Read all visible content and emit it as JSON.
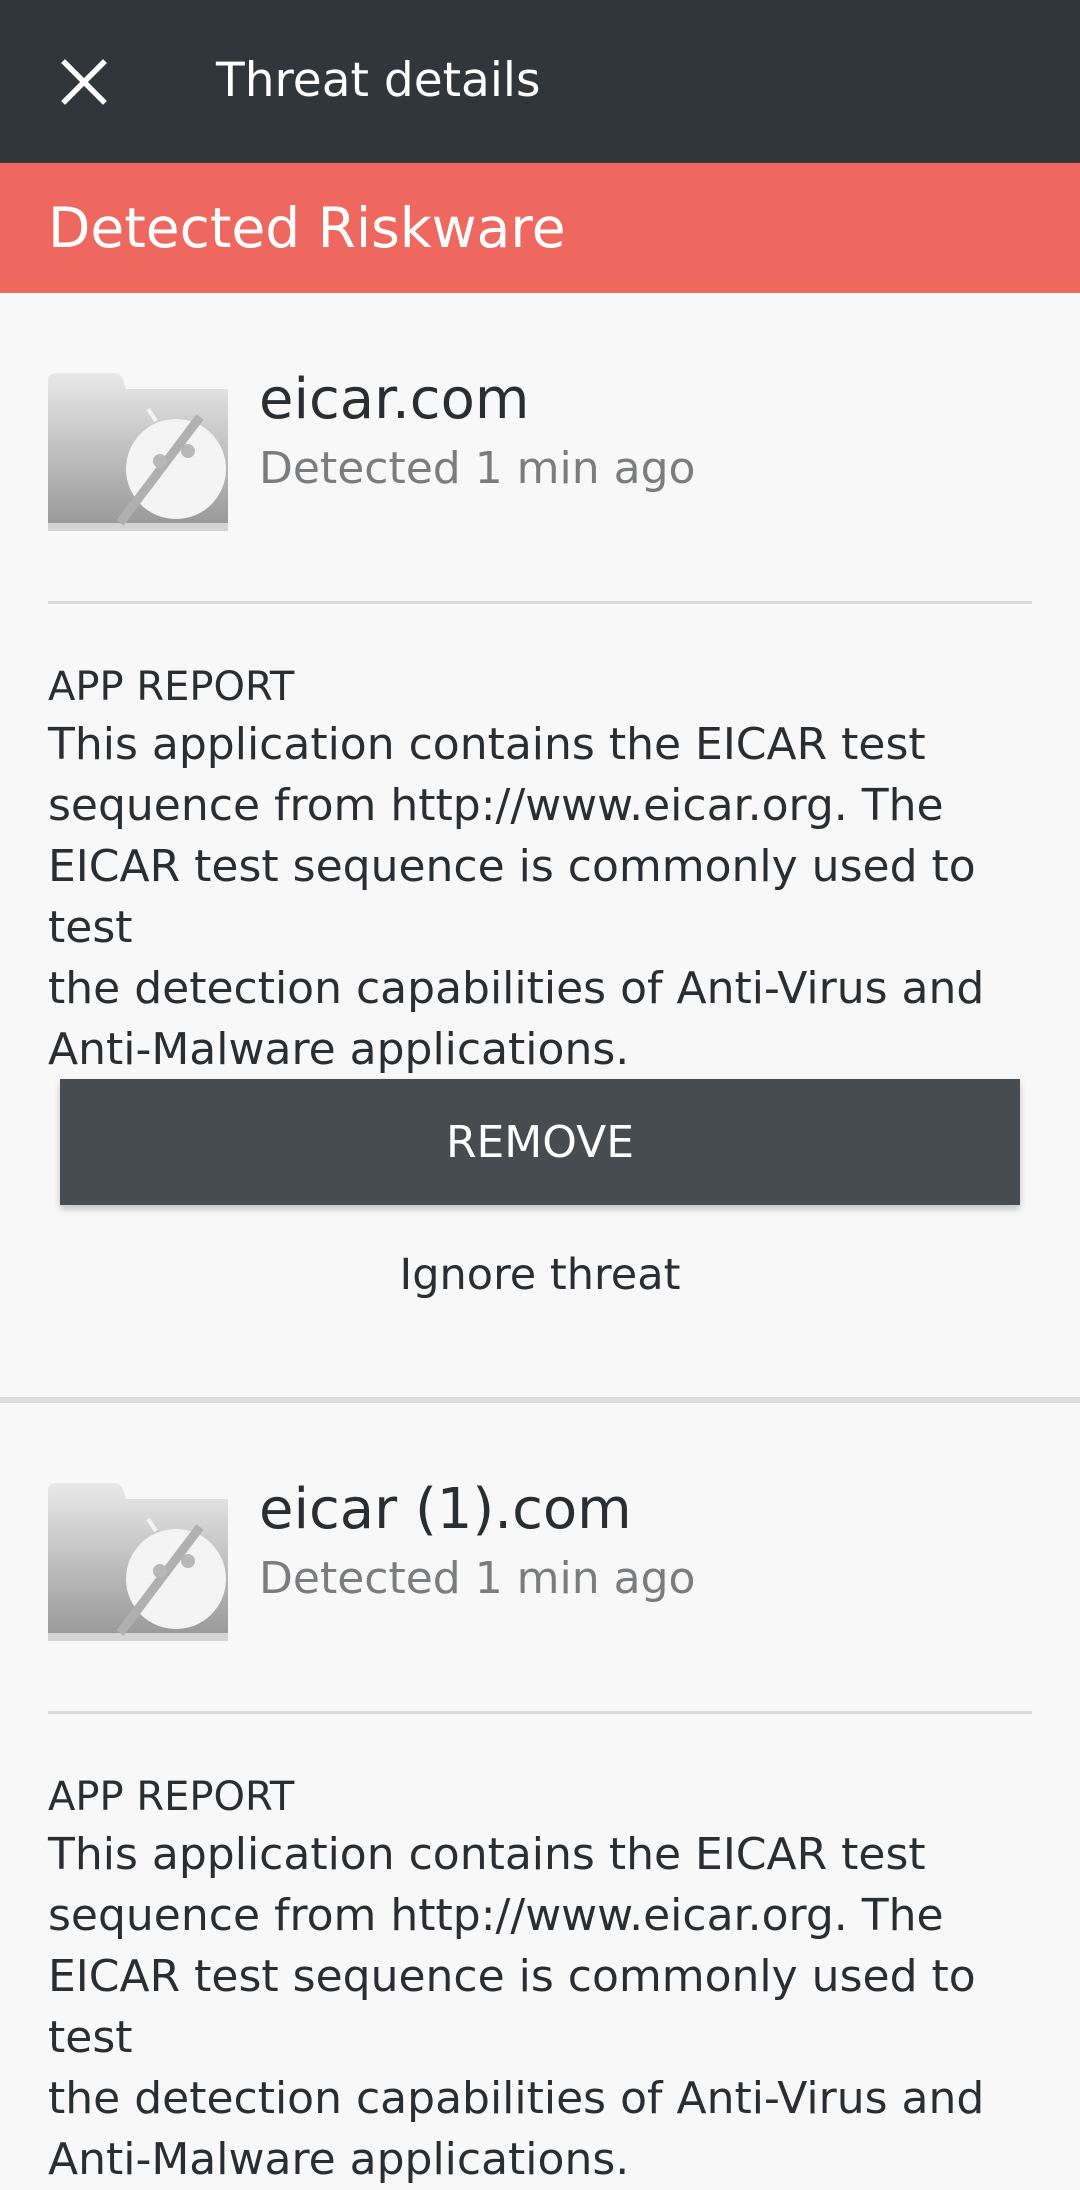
{
  "header": {
    "close_icon": "close-icon",
    "title": "Threat details"
  },
  "banner": {
    "label": "Detected Riskware",
    "color": "#ef6860"
  },
  "threats": [
    {
      "name": "eicar.com",
      "detected": "Detected 1 min ago",
      "icon": "android-file-icon",
      "report_heading": "APP REPORT",
      "report_lines": [
        "This application contains the EICAR test",
        "sequence from http://www.eicar.org.  The",
        "EICAR test sequence is commonly used to test",
        "the detection capabilities of Anti-Virus and",
        "Anti-Malware applications."
      ],
      "remove_label": "REMOVE",
      "ignore_label": "Ignore threat"
    },
    {
      "name": "eicar (1).com",
      "detected": "Detected 1 min ago",
      "icon": "android-file-icon",
      "report_heading": "APP REPORT",
      "report_lines": [
        "This application contains the EICAR test",
        "sequence from http://www.eicar.org.  The",
        "EICAR test sequence is commonly used to test",
        "the detection capabilities of Anti-Virus and",
        "Anti-Malware applications."
      ]
    }
  ],
  "colors": {
    "app_bar": "#31363a",
    "button": "#474c50",
    "background": "#f8f8f8"
  }
}
